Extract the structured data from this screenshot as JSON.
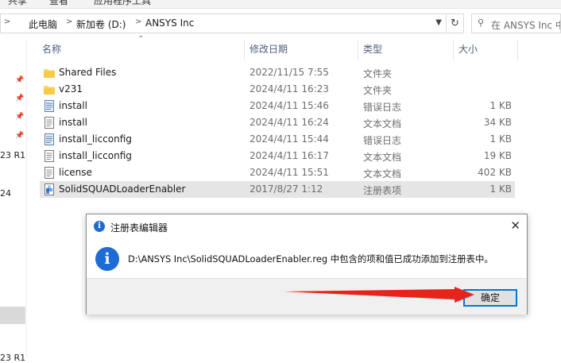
{
  "ribbon": {
    "items": [
      "共享",
      "查看",
      "应用程序工具"
    ]
  },
  "address": {
    "segments": [
      "此电脑",
      "新加卷 (D:)",
      "ANSYS Inc"
    ],
    "separator": ">",
    "dropdown_icon": "chevron-down-icon",
    "refresh_icon": "refresh-icon"
  },
  "search": {
    "placeholder": "在 ANSYS Inc 中搜索"
  },
  "nav": {
    "labels": [
      "23 R1",
      "24",
      "23 R1"
    ]
  },
  "columns": {
    "name": "名称",
    "date": "修改日期",
    "type": "类型",
    "size": "大小"
  },
  "files": [
    {
      "name": "Shared Files",
      "date": "2022/11/15 7:55",
      "type": "文件夹",
      "size": "",
      "icon": "folder-icon"
    },
    {
      "name": "v231",
      "date": "2024/4/11 16:23",
      "type": "文件夹",
      "size": "",
      "icon": "folder-icon"
    },
    {
      "name": "install",
      "date": "2024/4/11 15:46",
      "type": "错误日志",
      "size": "1 KB",
      "icon": "log-file-icon"
    },
    {
      "name": "install",
      "date": "2024/4/11 16:24",
      "type": "文本文档",
      "size": "34 KB",
      "icon": "text-file-icon"
    },
    {
      "name": "install_licconfig",
      "date": "2024/4/11 15:44",
      "type": "错误日志",
      "size": "1 KB",
      "icon": "log-file-icon"
    },
    {
      "name": "install_licconfig",
      "date": "2024/4/11 16:17",
      "type": "文本文档",
      "size": "19 KB",
      "icon": "text-file-icon"
    },
    {
      "name": "license",
      "date": "2024/4/11 15:51",
      "type": "文本文档",
      "size": "402 KB",
      "icon": "text-file-icon"
    },
    {
      "name": "SolidSQUADLoaderEnabler",
      "date": "2017/8/27 1:12",
      "type": "注册表项",
      "size": "1 KB",
      "icon": "registry-file-icon",
      "selected": true
    }
  ],
  "dialog": {
    "title": "注册表编辑器",
    "message": "D:\\ANSYS Inc\\SolidSQUADLoaderEnabler.reg 中包含的项和值已成功添加到注册表中。",
    "ok_label": "确定",
    "close_glyph": "✕",
    "info_glyph": "i"
  },
  "colors": {
    "dialog_accent": "#1d6bd6",
    "focus_border": "#0078d7",
    "annotation_arrow": "#e8231c",
    "header_text": "#4c607a"
  }
}
